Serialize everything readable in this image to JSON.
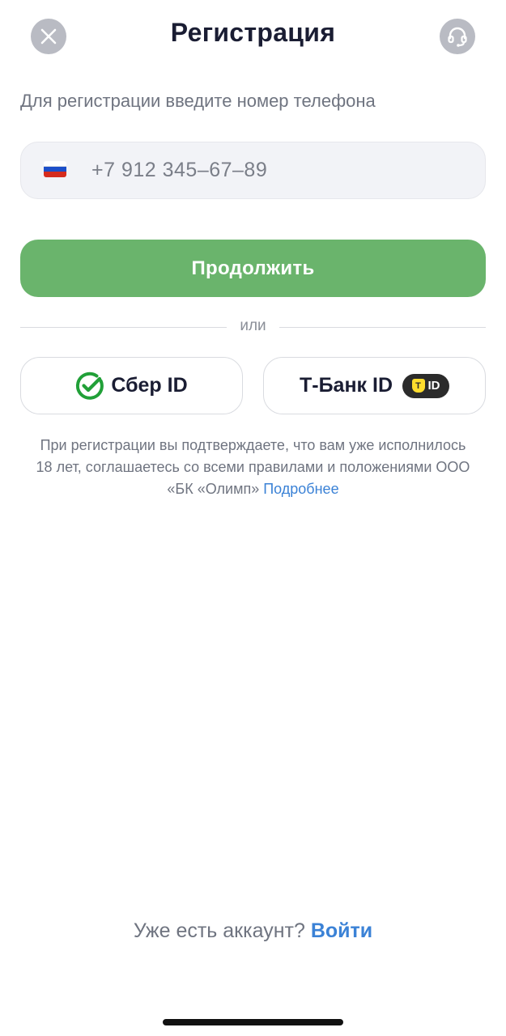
{
  "header": {
    "title": "Регистрация",
    "close_icon": "close-icon",
    "support_icon": "headset-icon"
  },
  "form": {
    "subtitle": "Для регистрации введите номер телефона",
    "country_flag": "russia-flag-icon",
    "phone_placeholder": "+7 912 345–67–89",
    "continue_label": "Продолжить"
  },
  "divider": {
    "text": "или"
  },
  "providers": {
    "sber_label": "Сбер ID",
    "tbank_label": "Т-Банк ID",
    "tbank_badge_text": "ID",
    "tbank_shield_letter": "T"
  },
  "legal": {
    "text": "При регистрации вы подтверждаете, что вам уже исполнилось 18 лет, соглашаетесь со всеми правилами и положениями ООО «БК «Олимп»",
    "more_link": "Подробнее"
  },
  "footer": {
    "question": "Уже есть аккаунт?",
    "login_link": "Войти"
  },
  "colors": {
    "primary_button": "#6ab46c",
    "link": "#3b82d6",
    "sber_green": "#21a038",
    "tbank_yellow": "#ffdd2d"
  }
}
